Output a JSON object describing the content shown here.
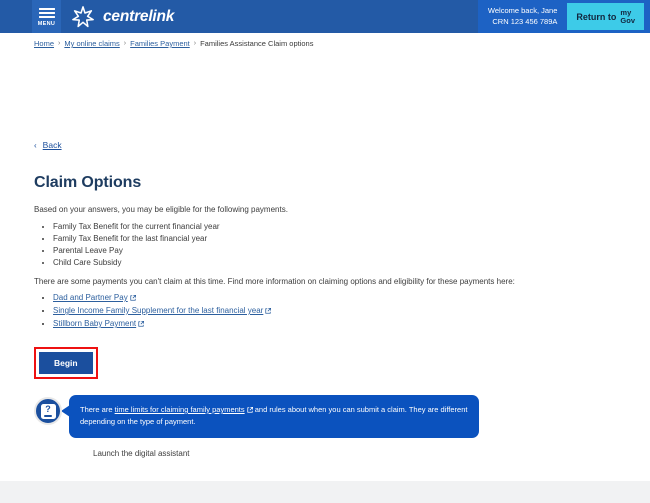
{
  "header": {
    "menu_label": "MENU",
    "brand_name": "centrelink",
    "logo_icon": "commonwealth-star-icon",
    "welcome_line1": "Welcome back, Jane",
    "welcome_line2": "CRN 123 456 789A",
    "mygov_button_prefix": "Return to",
    "mygov_my": "my",
    "mygov_gov": "Gov",
    "colors": {
      "header_bg": "#235aa6",
      "header_right_bg": "#1d62c4",
      "menu_bg": "#2a66b8",
      "mygov_btn_bg": "#3dcbe8"
    }
  },
  "breadcrumb": {
    "items": [
      {
        "label": "Home",
        "link": true
      },
      {
        "label": "My online claims",
        "link": true
      },
      {
        "label": "Families Payment",
        "link": true
      },
      {
        "label": "Families Assistance Claim options",
        "link": false
      }
    ],
    "separator": "›"
  },
  "main": {
    "back_label": "Back",
    "back_chevron": "‹",
    "page_title": "Claim Options",
    "intro": "Based on your answers, you may be eligible for the following payments.",
    "eligible_payments": [
      "Family Tax Benefit for the current financial year",
      "Family Tax Benefit for the last financial year",
      "Parental Leave Pay",
      "Child Care Subsidy"
    ],
    "unavailable_intro": "There are some payments you can't claim at this time. Find more information on claiming options and eligibility for these payments here:",
    "unavailable_links": [
      "Dad and Partner Pay",
      "Single Income Family Supplement for the last financial year",
      "Stillborn Baby Payment"
    ],
    "begin_label": "Begin",
    "begin_highlight_color": "#ee1111",
    "begin_button_color": "#1b4f9e"
  },
  "assistant": {
    "avatar_icon": "question-mark-assistant-icon",
    "bubble_text_before": "There are ",
    "bubble_link": "time limits for claiming family payments",
    "bubble_text_after": " and rules about when you can submit a claim. They are different depending on the type of payment.",
    "launch_label": "Launch the digital assistant",
    "bubble_color": "#0b52be"
  }
}
